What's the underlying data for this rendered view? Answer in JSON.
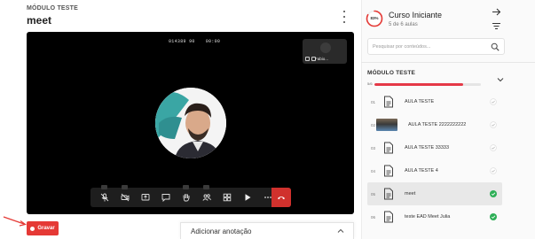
{
  "header": {
    "module_label": "MÓDULO TESTE",
    "lesson_title": "meet"
  },
  "video": {
    "meeting_code": "014389 90",
    "elapsed": "00:00",
    "self_view_name": "Fabio..."
  },
  "controls": {
    "record_label": "Gravar",
    "annotation_label": "Adicionar anotação"
  },
  "sidebar": {
    "progress_percent": "83%",
    "progress_value": 0.83,
    "course_title": "Curso Iniciante",
    "course_subtitle": "5 de 6 aulas",
    "search_placeholder": "Pesquisar por conteúdos...",
    "module_title": "MÓDULO TESTE",
    "module_count": "5/6",
    "module_progress": 0.83,
    "lessons": [
      {
        "num": "01",
        "title": "AULA TESTE",
        "status": "pending",
        "thumbnail": false
      },
      {
        "num": "02",
        "title": "AULA TESTE 2222222222",
        "status": "pending",
        "thumbnail": true
      },
      {
        "num": "03",
        "title": "AULA TESTE 33333",
        "status": "pending",
        "thumbnail": false
      },
      {
        "num": "04",
        "title": "AULA TESTE 4",
        "status": "pending",
        "thumbnail": false
      },
      {
        "num": "05",
        "title": "meet",
        "status": "done",
        "thumbnail": false,
        "active": true
      },
      {
        "num": "06",
        "title": "teste EAD Meet Julia",
        "status": "done",
        "thumbnail": false
      }
    ]
  },
  "colors": {
    "accent_red": "#e53935",
    "done_green": "#2eaf57",
    "video_bg": "#000000"
  }
}
